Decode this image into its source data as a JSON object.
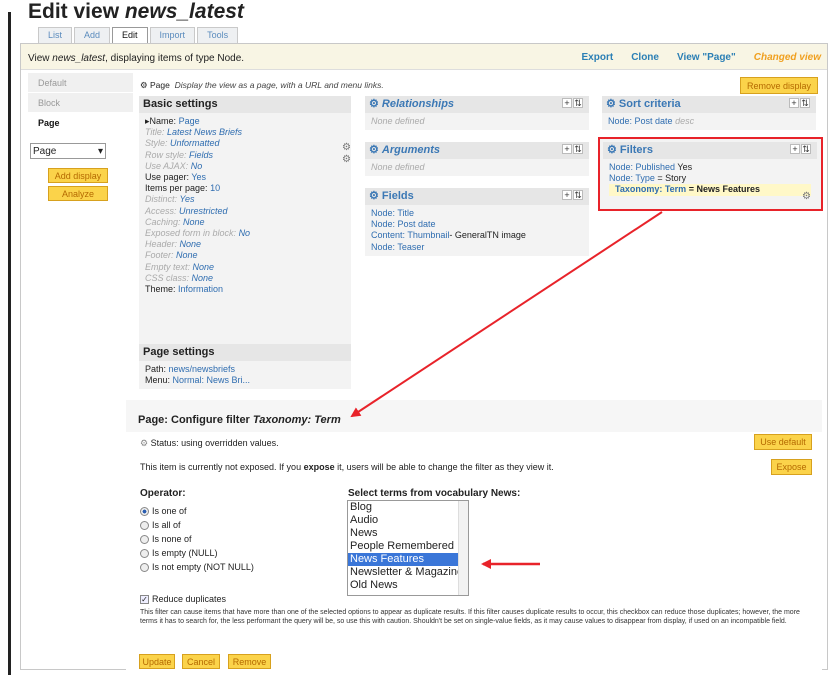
{
  "page_title": {
    "prefix": "Edit view ",
    "name": "news_latest"
  },
  "tabs": [
    {
      "label": "List"
    },
    {
      "label": "Add"
    },
    {
      "label": "Edit"
    },
    {
      "label": "Import"
    },
    {
      "label": "Tools"
    }
  ],
  "header": {
    "text_pre": "View ",
    "text_name": "news_latest",
    "text_post": ", displaying items of type Node.",
    "links": {
      "export": "Export",
      "clone": "Clone",
      "view_page": "View \"Page\"",
      "changed": "Changed view"
    }
  },
  "displays": [
    {
      "label": "Default"
    },
    {
      "label": "Block"
    },
    {
      "label": "Page"
    }
  ],
  "display_select": {
    "value": "Page"
  },
  "buttons": {
    "add_display": "Add display",
    "analyze": "Analyze",
    "remove_display": "Remove display",
    "use_default": "Use default",
    "expose": "Expose",
    "update": "Update",
    "cancel": "Cancel",
    "remove": "Remove"
  },
  "page_line": {
    "label": "Page",
    "desc": "Display the view as a page, with a URL and menu links."
  },
  "basic": {
    "title": "Basic settings",
    "rows": [
      {
        "k": "Name:",
        "v": "Page"
      },
      {
        "k": "Title:",
        "v": "Latest News Briefs"
      },
      {
        "k": "Style:",
        "v": "Unformatted"
      },
      {
        "k": "Row style:",
        "v": "Fields"
      },
      {
        "k": "Use AJAX:",
        "v": "No"
      },
      {
        "k": "Use pager:",
        "v": "Yes"
      },
      {
        "k": "Items per page:",
        "v": "10"
      },
      {
        "k": "Distinct:",
        "v": "Yes"
      },
      {
        "k": "Access:",
        "v": "Unrestricted"
      },
      {
        "k": "Caching:",
        "v": "None"
      },
      {
        "k": "Exposed form in block:",
        "v": "No"
      },
      {
        "k": "Header:",
        "v": "None"
      },
      {
        "k": "Footer:",
        "v": "None"
      },
      {
        "k": "Empty text:",
        "v": "None"
      },
      {
        "k": "CSS class:",
        "v": "None"
      },
      {
        "k": "Theme:",
        "v": "Information"
      }
    ]
  },
  "relationships": {
    "title": "Relationships",
    "body": "None defined"
  },
  "arguments": {
    "title": "Arguments",
    "body": "None defined"
  },
  "fields": {
    "title": "Fields",
    "items": [
      "Node: Title",
      "Node: Post date",
      "Content: Thumbnail",
      "GeneralTN image",
      "Node: Teaser"
    ]
  },
  "sort": {
    "title": "Sort criteria",
    "item_b": "Node: Post date",
    "item_g": "desc"
  },
  "filters": {
    "title": "Filters",
    "rows": [
      {
        "a": "Node: Published",
        "b": "Yes"
      },
      {
        "a": "Node: Type",
        "b": "= Story"
      },
      {
        "a": "Taxonomy: Term",
        "b": "= News Features"
      }
    ]
  },
  "page_settings": {
    "title": "Page settings",
    "path_k": "Path:",
    "path_v": "news/newsbriefs",
    "menu_k": "Menu:",
    "menu_v": "Normal: News Bri..."
  },
  "configure": {
    "title_pre": "Page: Configure filter ",
    "title_name": "Taxonomy: Term",
    "status": "Status: using overridden values.",
    "expose_pre": "This item is currently not exposed. If you ",
    "expose_word": "expose",
    "expose_post": " it, users will be able to change the filter as they view it.",
    "operator_label": "Operator:",
    "operators": [
      {
        "label": "Is one of",
        "checked": true
      },
      {
        "label": "Is all of"
      },
      {
        "label": "Is none of"
      },
      {
        "label": "Is empty (NULL)"
      },
      {
        "label": "Is not empty (NOT NULL)"
      }
    ],
    "terms_label": "Select terms from vocabulary News:",
    "terms": [
      {
        "label": "Blog"
      },
      {
        "label": "Audio"
      },
      {
        "label": "News"
      },
      {
        "label": "People Remembered"
      },
      {
        "label": "News Features",
        "selected": true
      },
      {
        "label": "Newsletter & Magazine"
      },
      {
        "label": "Old News"
      }
    ],
    "reduce_label": "Reduce duplicates",
    "help": "This filter can cause items that have more than one of the selected options to appear as duplicate results. If this filter causes duplicate results to occur, this checkbox can reduce those duplicates; however, the more terms it has to search for, the less performant the query will be, so use this with caution. Shouldn't be set on single-value fields, as it may cause values to disappear from display, if used on an incompatible field."
  },
  "colors": {
    "accent_button": "#fbd34a",
    "highlight_box": "#e8232a",
    "link": "#2f6db0",
    "changed": "#f0a020"
  }
}
